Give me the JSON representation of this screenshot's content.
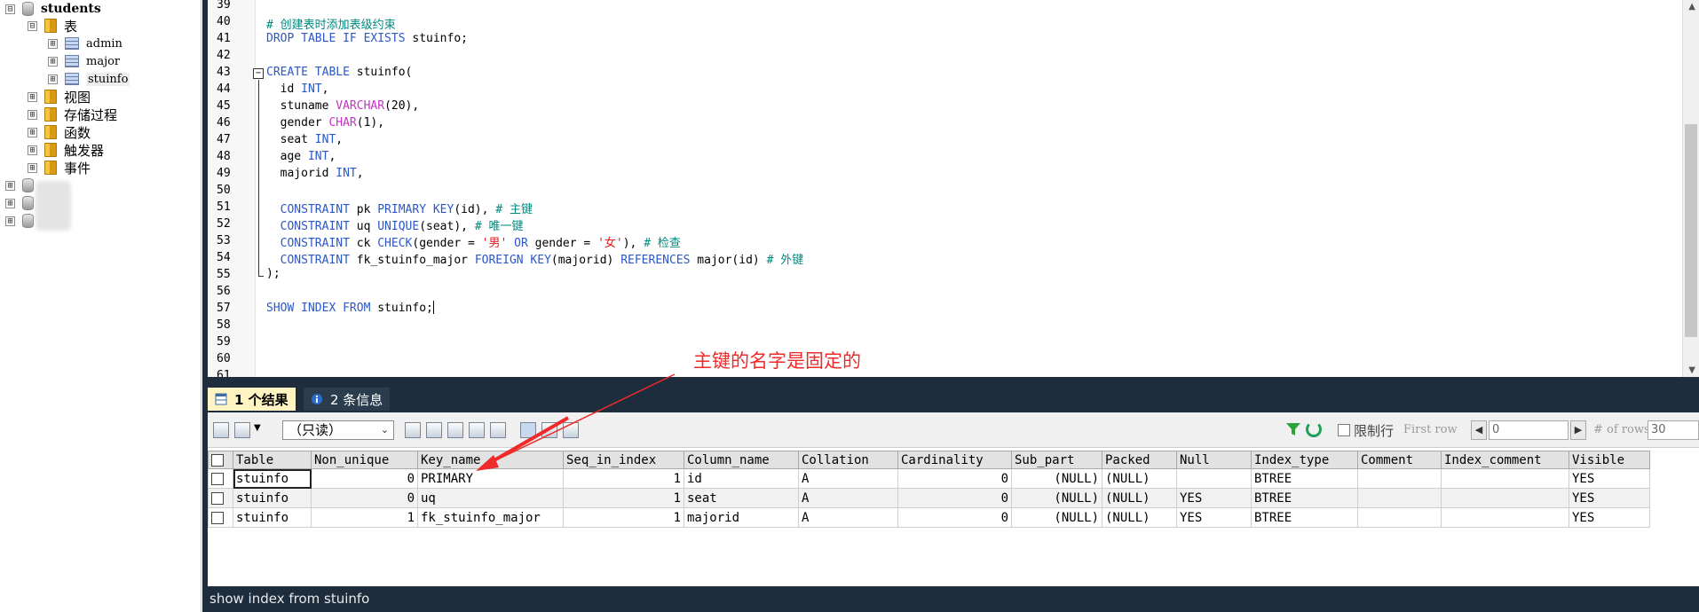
{
  "tree": {
    "database": "students",
    "tables_folder": "表",
    "tables": [
      "admin",
      "major",
      "stuinfo"
    ],
    "folders": [
      "视图",
      "存储过程",
      "函数",
      "触发器",
      "事件"
    ],
    "expand_minus": "⊟",
    "expand_plus": "⊞"
  },
  "editor": {
    "line_numbers": [
      "39",
      "40",
      "41",
      "42",
      "43",
      "44",
      "45",
      "46",
      "47",
      "48",
      "49",
      "50",
      "51",
      "52",
      "53",
      "54",
      "55",
      "56",
      "57",
      "58",
      "59",
      "60",
      "61"
    ],
    "fold_glyph": "−"
  },
  "code": {
    "l40": "# 创建表时添加表级约束",
    "l41_kw": "DROP TABLE IF EXISTS",
    "l41_rest": " stuinfo;",
    "l43_kw": "CREATE TABLE",
    "l43_rest": " stuinfo(",
    "l44_a": "  id ",
    "l44_t": "INT",
    "l44_b": ",",
    "l45_a": "  stuname ",
    "l45_t": "VARCHAR",
    "l45_b": "(20),",
    "l46_a": "  gender ",
    "l46_t": "CHAR",
    "l46_b": "(1),",
    "l47_a": "  seat ",
    "l47_t": "INT",
    "l47_b": ",",
    "l48_a": "  age ",
    "l48_t": "INT",
    "l48_b": ",",
    "l49_a": "  majorid ",
    "l49_t": "INT",
    "l49_b": ",",
    "l51_kw1": "  CONSTRAINT",
    "l51_a": " pk ",
    "l51_kw2": "PRIMARY KEY",
    "l51_b": "(id), ",
    "l51_c": "# 主键",
    "l52_kw1": "  CONSTRAINT",
    "l52_a": " uq ",
    "l52_kw2": "UNIQUE",
    "l52_b": "(seat), ",
    "l52_c": "# 唯一键",
    "l53_kw1": "  CONSTRAINT",
    "l53_a": " ck ",
    "l53_kw2": "CHECK",
    "l53_b": "(gender = ",
    "l53_s1": "'男'",
    "l53_kw3": " OR",
    "l53_d": " gender = ",
    "l53_s2": "'女'",
    "l53_e": "), ",
    "l53_c": "# 检查",
    "l54_kw1": "  CONSTRAINT",
    "l54_a": " fk_stuinfo_major ",
    "l54_kw2": "FOREIGN KEY",
    "l54_b": "(majorid) ",
    "l54_kw3": "REFERENCES",
    "l54_d": " major(id) ",
    "l54_c": "# 外键",
    "l55": ");",
    "l57_kw": "SHOW INDEX FROM",
    "l57_rest": " stuinfo;"
  },
  "tabs": {
    "results_label": "1 个结果",
    "messages_label": "2 条信息"
  },
  "toolbar": {
    "mode_select": "（只读）",
    "limit_label": "限制行",
    "first_row_label": "First row",
    "first_row_value": "0",
    "rows_label": "# of rows",
    "rows_value": "30"
  },
  "grid": {
    "columns": [
      "Table",
      "Non_unique",
      "Key_name",
      "Seq_in_index",
      "Column_name",
      "Collation",
      "Cardinality",
      "Sub_part",
      "Packed",
      "Null",
      "Index_type",
      "Comment",
      "Index_comment",
      "Visible"
    ],
    "rows": [
      [
        "stuinfo",
        "0",
        "PRIMARY",
        "1",
        "id",
        "A",
        "0",
        "(NULL)",
        "(NULL)",
        "",
        "BTREE",
        "",
        "",
        "YES"
      ],
      [
        "stuinfo",
        "0",
        "uq",
        "1",
        "seat",
        "A",
        "0",
        "(NULL)",
        "(NULL)",
        "YES",
        "BTREE",
        "",
        "",
        "YES"
      ],
      [
        "stuinfo",
        "1",
        "fk_stuinfo_major",
        "1",
        "majorid",
        "A",
        "0",
        "(NULL)",
        "(NULL)",
        "YES",
        "BTREE",
        "",
        "",
        "YES"
      ]
    ]
  },
  "status_text": "show index from stuinfo",
  "annotation": "主键的名字是固定的",
  "colors": {
    "keyword": "#2b57c8",
    "type": "#c632c6",
    "comment": "#008a80",
    "string": "#e01a1a",
    "annotation": "#ee2a2a",
    "panel_dark": "#1e2d3d"
  }
}
